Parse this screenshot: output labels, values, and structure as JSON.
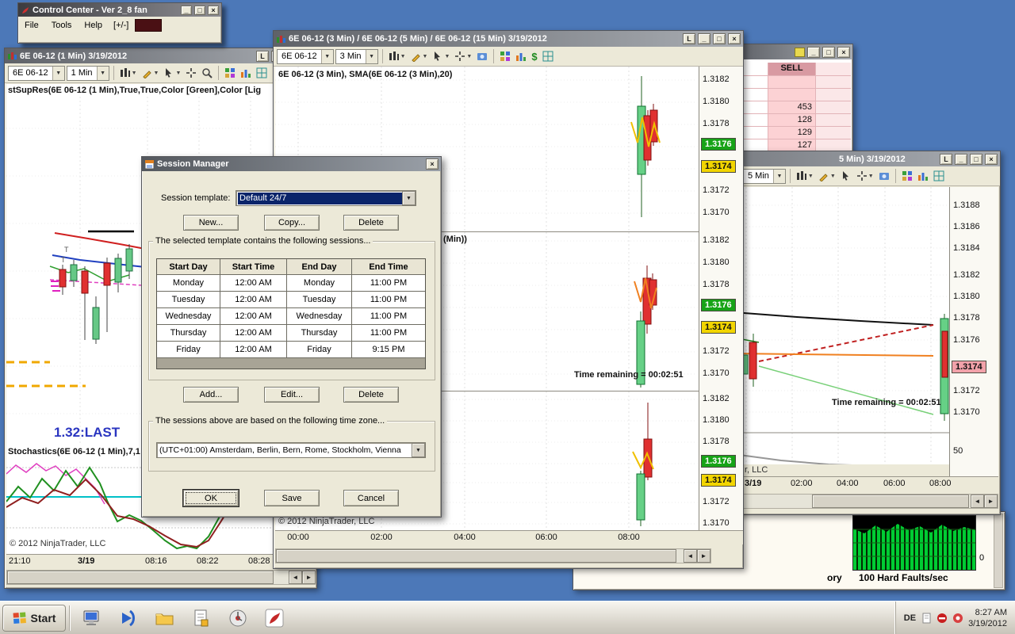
{
  "control_center": {
    "title": "Control Center - Ver 2_8 fan",
    "menus": [
      "File",
      "Tools",
      "Help",
      "[+/-]"
    ]
  },
  "chart1": {
    "title": "6E 06-12 (1 Min)  3/19/2012",
    "lock": "L",
    "instrument": "6E 06-12",
    "interval": "1 Min",
    "indicator_label": "stSupRes(6E 06-12 (1 Min),True,True,Color [Green],Color [Lig",
    "last_label": "1.32:LAST",
    "stoch_label": "Stochastics(6E 06-12 (1 Min),7,1",
    "copyright": "© 2012 NinjaTrader, LLC",
    "time_ticks": [
      "21:10",
      "3/19",
      "08:16",
      "08:22",
      "08:28"
    ]
  },
  "chart3": {
    "title": "6E 06-12 (3 Min) / 6E 06-12 (5 Min) / 6E 06-12 (15 Min)  3/19/2012",
    "lock": "L",
    "instrument": "6E 06-12",
    "interval": "3 Min",
    "panel1_label": "6E 06-12 (3 Min), SMA(6E 06-12 (3 Min),20)",
    "panel2_label_fragment": "(Min))",
    "time_remaining": "Time remaining = 00:02:51",
    "ticks": [
      "1.3182",
      "1.3180",
      "1.3178",
      "1.3176",
      "1.3174",
      "1.3172",
      "1.3170"
    ],
    "last_price": "1.3176",
    "ask_price": "1.3174",
    "copyright": "© 2012 NinjaTrader, LLC",
    "time_ticks": [
      "00:00",
      "02:00",
      "04:00",
      "06:00",
      "08:00"
    ]
  },
  "dom": {
    "sell_header": "SELL",
    "rows": [
      "",
      "",
      "453",
      "128",
      "129",
      "127"
    ]
  },
  "chart15": {
    "title_fragment": "5 Min)  3/19/2012",
    "lock": "L",
    "interval_fragment": "5 Min",
    "time_remaining": "Time remaining = 00:02:51",
    "ticks": [
      "1.3188",
      "1.3186",
      "1.3184",
      "1.3182",
      "1.3180",
      "1.3178",
      "1.3176",
      "1.3172",
      "1.3170"
    ],
    "price_badge": "1.3174",
    "osc_tick": "50",
    "copyright_fragment": "r, LLC",
    "time_ticks": [
      "3/19",
      "02:00",
      "04:00",
      "06:00",
      "08:00"
    ]
  },
  "resource": {
    "memory_fragment": "ory",
    "graph_title": "100 Hard Faults/sec",
    "scale_min": "0"
  },
  "session_manager": {
    "title": "Session Manager",
    "template_label": "Session template:",
    "template_value": "Default 24/7",
    "buttons_top": [
      "New...",
      "Copy...",
      "Delete"
    ],
    "group1_label": "The selected template contains the following sessions...",
    "table": {
      "headers": [
        "Start Day",
        "Start Time",
        "End Day",
        "End Time"
      ],
      "rows": [
        {
          "start_day": "Monday",
          "start_time": "12:00 AM",
          "end_day": "Monday",
          "end_time": "11:00 PM"
        },
        {
          "start_day": "Tuesday",
          "start_time": "12:00 AM",
          "end_day": "Tuesday",
          "end_time": "11:00 PM"
        },
        {
          "start_day": "Wednesday",
          "start_time": "12:00 AM",
          "end_day": "Wednesday",
          "end_time": "11:00 PM"
        },
        {
          "start_day": "Thursday",
          "start_time": "12:00 AM",
          "end_day": "Thursday",
          "end_time": "11:00 PM"
        },
        {
          "start_day": "Friday",
          "start_time": "12:00 AM",
          "end_day": "Friday",
          "end_time": "9:15 PM"
        }
      ]
    },
    "buttons_mid": [
      "Add...",
      "Edit...",
      "Delete"
    ],
    "group2_label": "The sessions above are based on the following time zone...",
    "timezone_value": "(UTC+01:00) Amsterdam, Berlin, Bern, Rome, Stockholm, Vienna",
    "buttons_bottom": [
      "OK",
      "Save",
      "Cancel"
    ]
  },
  "taskbar": {
    "start": "Start",
    "lang": "DE",
    "time": "8:27 AM",
    "date": "3/19/2012"
  }
}
